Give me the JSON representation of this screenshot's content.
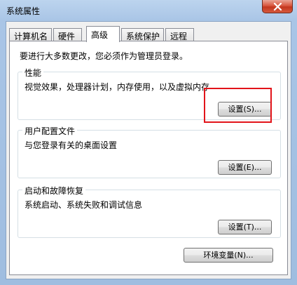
{
  "window": {
    "title": "系统属性"
  },
  "tabs": [
    {
      "label": "计算机名",
      "active": false
    },
    {
      "label": "硬件",
      "active": false
    },
    {
      "label": "高级",
      "active": true
    },
    {
      "label": "系统保护",
      "active": false
    },
    {
      "label": "远程",
      "active": false
    }
  ],
  "admin_note": "要进行大多数更改，您必须作为管理员登录。",
  "groups": {
    "performance": {
      "title": "性能",
      "description": "视觉效果，处理器计划，内存使用，以及虚拟内存",
      "button": "设置(S)..."
    },
    "user_profiles": {
      "title": "用户配置文件",
      "description": "与您登录有关的桌面设置",
      "button": "设置(E)..."
    },
    "startup_recovery": {
      "title": "启动和故障恢复",
      "description": "系统启动、系统失败和调试信息",
      "button": "设置(T)..."
    }
  },
  "env_button": "环境变量(N)...",
  "colors": {
    "highlight": "#e2141a",
    "close_button": "#c3361d"
  },
  "icons": {
    "close": "close-icon"
  }
}
